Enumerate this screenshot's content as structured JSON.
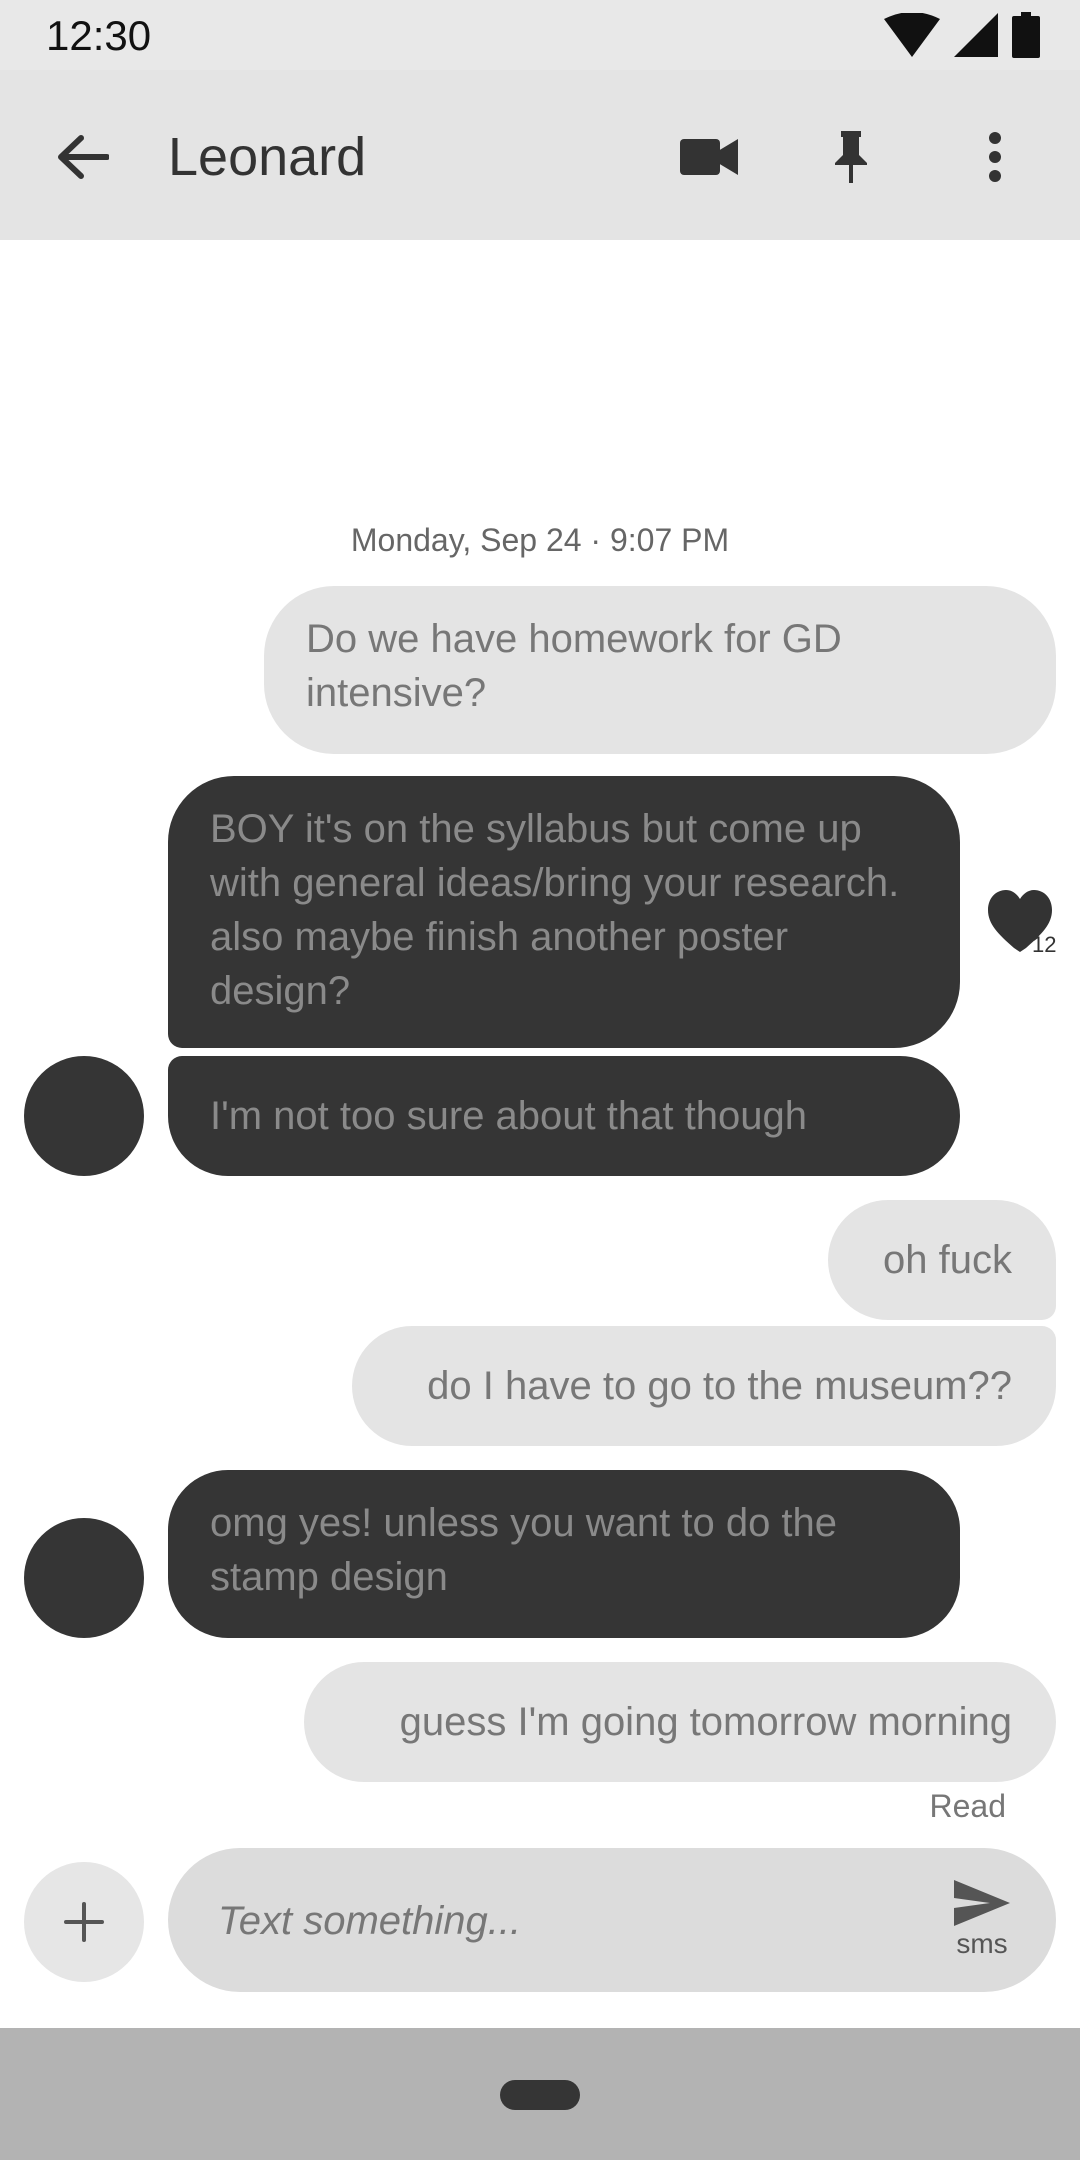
{
  "status_bar": {
    "time": "12:30",
    "icons": [
      "wifi-icon",
      "cellular-signal-icon",
      "battery-icon"
    ]
  },
  "app_bar": {
    "title": "Leonard",
    "actions": [
      "back-arrow-icon",
      "video-call-icon",
      "pin-icon",
      "more-vert-icon"
    ]
  },
  "conversation": {
    "date_header": "Monday, Sep 24 · 9:07 PM",
    "messages": [
      {
        "direction": "outgoing",
        "text": "Do we have homework for GD intensive?"
      },
      {
        "direction": "incoming",
        "text": "BOY it's on the syllabus but come up with general ideas/bring your research. also maybe finish another poster design?",
        "reaction": {
          "icon": "heart-icon",
          "count": "12"
        }
      },
      {
        "direction": "incoming",
        "text": "I'm not too sure about that though"
      },
      {
        "direction": "outgoing",
        "text": "oh fuck"
      },
      {
        "direction": "outgoing",
        "text": "do I have to go to the museum??"
      },
      {
        "direction": "incoming",
        "text": "omg yes! unless you want to do the stamp design"
      },
      {
        "direction": "outgoing",
        "text": "guess I'm going tomorrow morning"
      }
    ],
    "read_receipt": "Read"
  },
  "composer": {
    "placeholder": "Text something...",
    "send_label": "sms"
  },
  "colors": {
    "header_bg": "#e4e4e4",
    "outgoing_bubble": "#e4e4e4",
    "incoming_bubble": "#353535",
    "nav_bar": "#b3b3b3"
  }
}
